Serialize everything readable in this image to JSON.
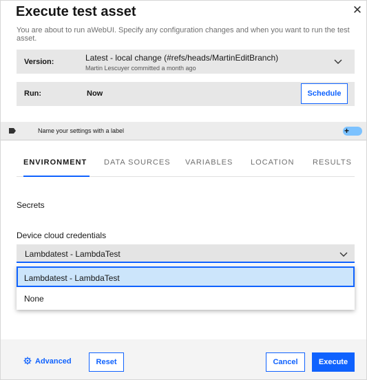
{
  "dialog": {
    "title": "Execute test asset",
    "description": "You are about to run aWebUI. Specify any configuration changes and when you want to run the test asset."
  },
  "version": {
    "label": "Version:",
    "value": "Latest - local change (#refs/heads/MartinEditBranch)",
    "subtext": "Martin Lescuyer committed a month ago"
  },
  "run": {
    "label": "Run:",
    "value": "Now",
    "schedule_label": "Schedule"
  },
  "label_bar": {
    "text": "Name your settings with a label",
    "toggle_symbol": "+"
  },
  "tabs": [
    {
      "label": "ENVIRONMENT",
      "active": true
    },
    {
      "label": "DATA SOURCES",
      "active": false
    },
    {
      "label": "VARIABLES",
      "active": false
    },
    {
      "label": "LOCATION",
      "active": false
    },
    {
      "label": "RESULTS",
      "active": false
    }
  ],
  "environment": {
    "section_title": "Secrets",
    "field_label": "Device cloud credentials",
    "selected_value": "Lambdatest - LambdaTest",
    "options": [
      "Lambdatest - LambdaTest",
      "None"
    ]
  },
  "footer": {
    "advanced_label": "Advanced",
    "reset_label": "Reset",
    "cancel_label": "Cancel",
    "execute_label": "Execute"
  },
  "icons": {
    "close": "close-icon",
    "chevron": "chevron-down-icon",
    "tag": "tag-icon",
    "gear": "gear-icon"
  },
  "colors": {
    "accent": "#0f62fe",
    "selected_option_bg": "#cce5fb",
    "toggle": "#7cc2ff"
  }
}
